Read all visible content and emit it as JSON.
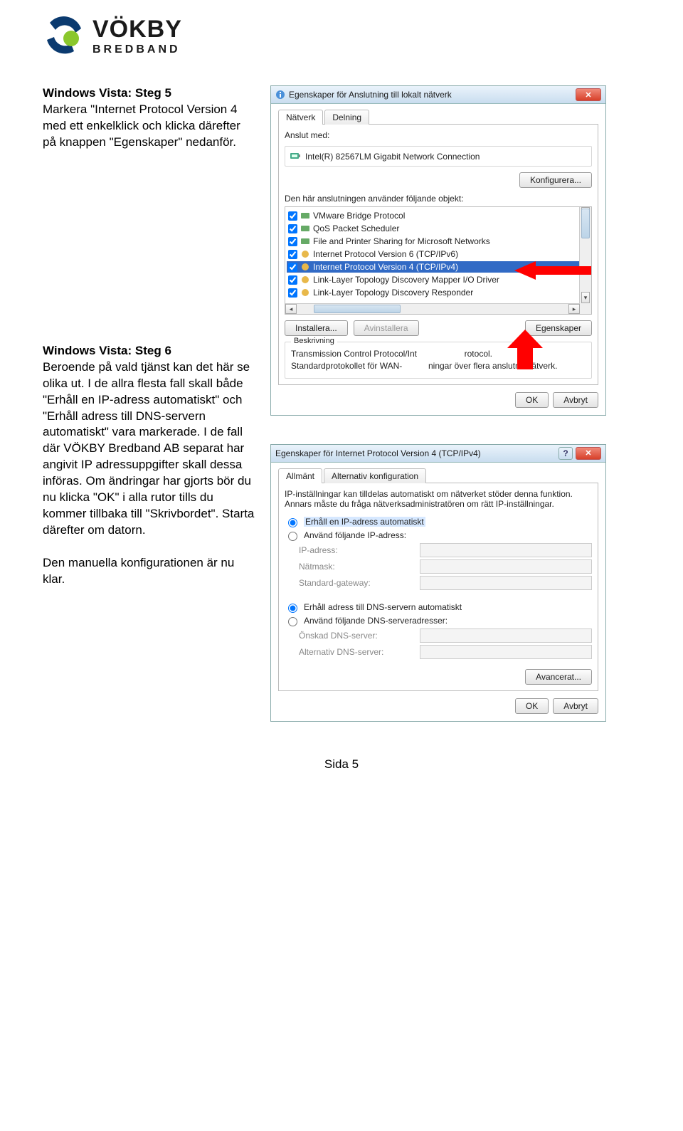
{
  "logo": {
    "name": "VÖKBY",
    "sub": "BREDBAND"
  },
  "step5": {
    "title": "Windows Vista: Steg 5",
    "body": "Markera \"Internet Protocol Version 4 med ett enkelklick och klicka därefter på knappen \"Egenskaper\" nedanför."
  },
  "step6": {
    "title": "Windows Vista: Steg 6",
    "body": "Beroende på vald tjänst kan det här se olika ut. I de allra flesta fall skall både \"Erhåll en IP-adress automatiskt\" och \"Erhåll adress till DNS-servern automatiskt\" vara markerade. I de fall där VÖKBY Bredband AB separat har angivit IP adressuppgifter skall dessa införas. Om ändringar har gjorts bör du nu klicka \"OK\" i alla rutor tills du kommer tillbaka till \"Skrivbordet\". Starta därefter om datorn.",
    "line2": "Den manuella konfigurationen är nu klar."
  },
  "dlg1": {
    "title": "Egenskaper för Anslutning till lokalt nätverk",
    "tabs": [
      "Nätverk",
      "Delning"
    ],
    "connect_label": "Anslut med:",
    "adapter": "Intel(R) 82567LM Gigabit Network Connection",
    "configure_btn": "Konfigurera...",
    "uses_label": "Den här anslutningen använder följande objekt:",
    "items": [
      "VMware Bridge Protocol",
      "QoS Packet Scheduler",
      "File and Printer Sharing for Microsoft Networks",
      "Internet Protocol Version 6 (TCP/IPv6)",
      "Internet Protocol Version 4 (TCP/IPv4)",
      "Link-Layer Topology Discovery Mapper I/O Driver",
      "Link-Layer Topology Discovery Responder"
    ],
    "install_btn": "Installera...",
    "uninstall_btn": "Avinstallera",
    "props_btn": "Egenskaper",
    "desc_heading": "Beskrivning",
    "desc_text1": "Transmission Control Protocol/Int",
    "desc_text2": "rotocol.",
    "desc_text3": "Standardprotokollet för WAN-",
    "desc_text4": "ningar över flera anslutna nätverk.",
    "ok": "OK",
    "cancel": "Avbryt"
  },
  "dlg2": {
    "title": "Egenskaper för Internet Protocol Version 4 (TCP/IPv4)",
    "tabs": [
      "Allmänt",
      "Alternativ konfiguration"
    ],
    "intro": "IP-inställningar kan tilldelas automatiskt om nätverket stöder denna funktion. Annars måste du fråga nätverksadministratören om rätt IP-inställningar.",
    "radio_auto_ip": "Erhåll en IP-adress automatiskt",
    "radio_manual_ip": "Använd följande IP-adress:",
    "ip_label": "IP-adress:",
    "mask_label": "Nätmask:",
    "gw_label": "Standard-gateway:",
    "radio_auto_dns": "Erhåll adress till DNS-servern automatiskt",
    "radio_manual_dns": "Använd följande DNS-serveradresser:",
    "dns1_label": "Önskad DNS-server:",
    "dns2_label": "Alternativ DNS-server:",
    "advanced_btn": "Avancerat...",
    "ok": "OK",
    "cancel": "Avbryt"
  },
  "footer": "Sida 5"
}
